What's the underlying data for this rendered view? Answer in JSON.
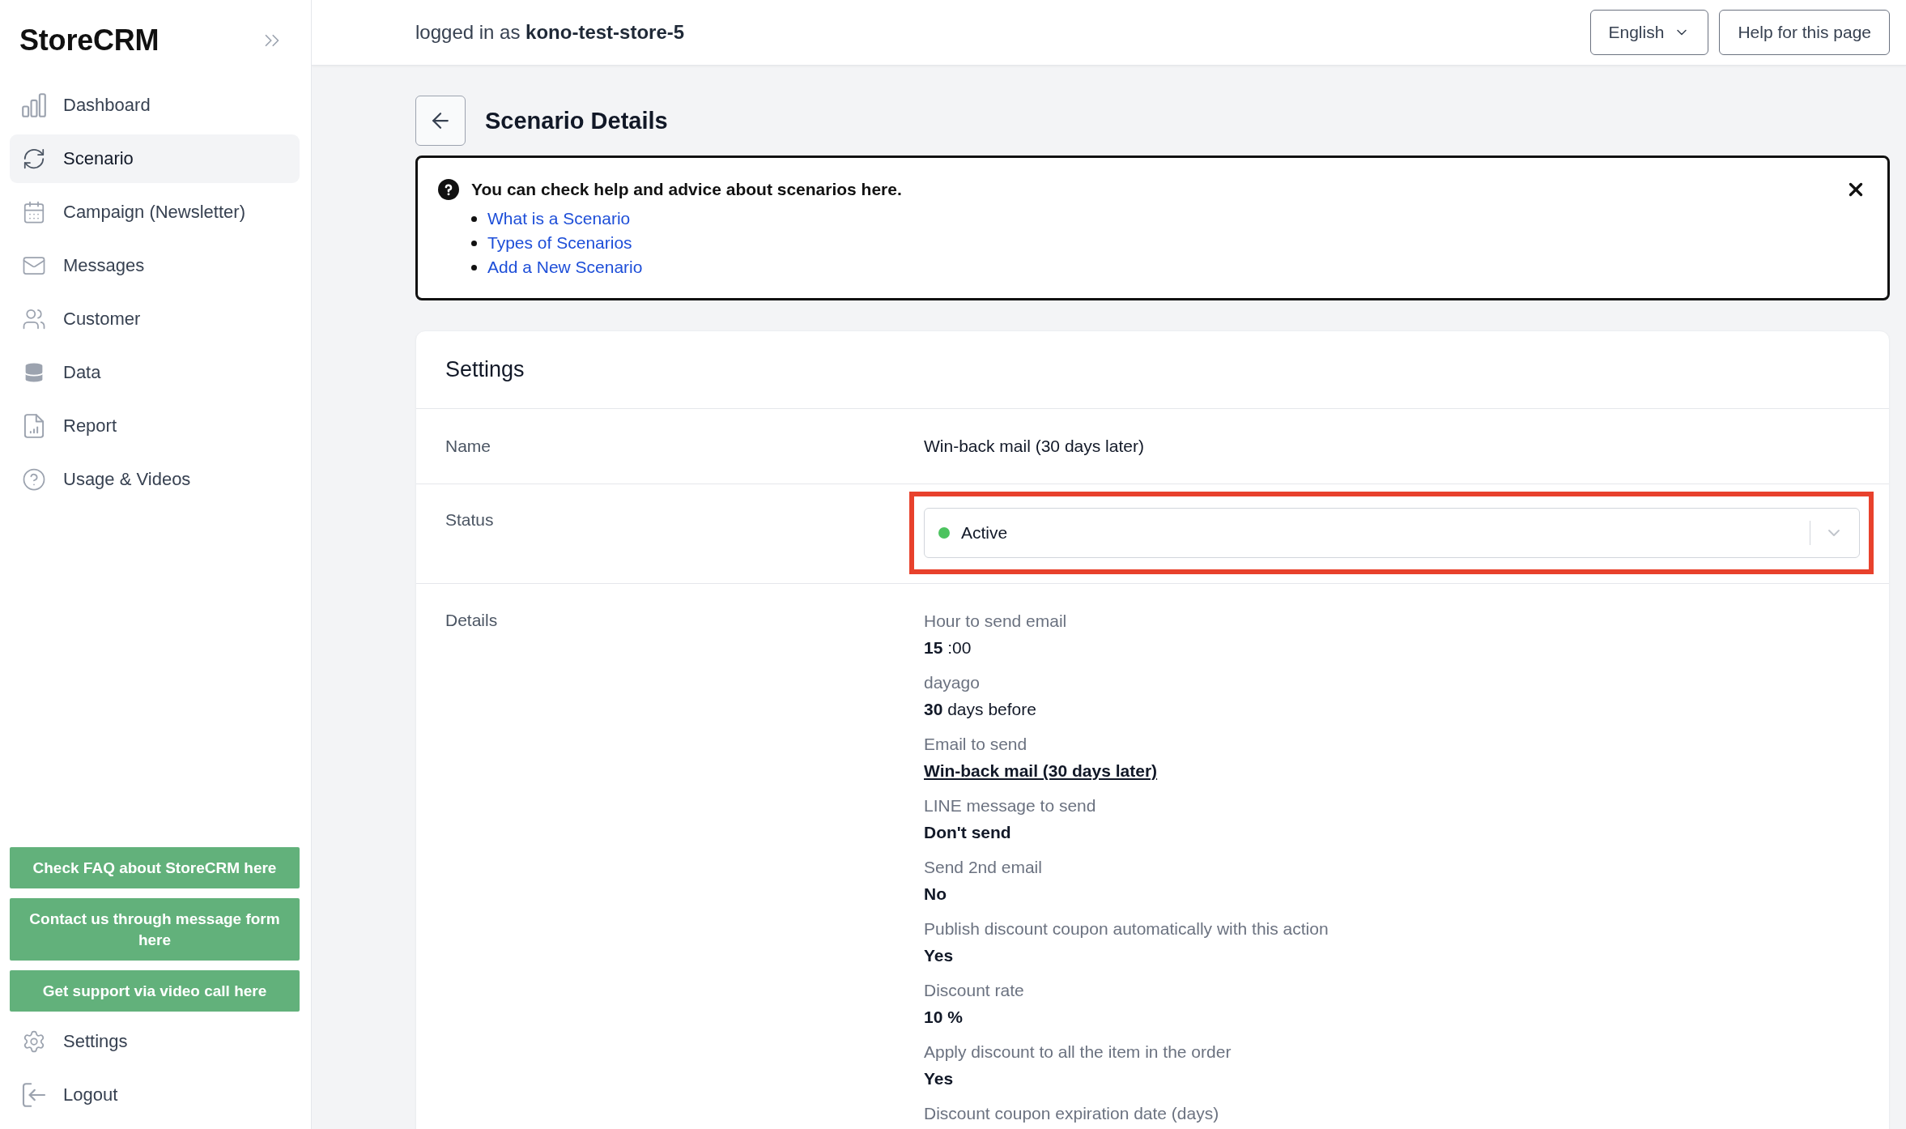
{
  "sidebar": {
    "logo": "StoreCRM",
    "nav_items": [
      {
        "label": "Dashboard",
        "selected": false
      },
      {
        "label": "Scenario",
        "selected": true
      },
      {
        "label": "Campaign (Newsletter)",
        "selected": false
      },
      {
        "label": "Messages",
        "selected": false
      },
      {
        "label": "Customer",
        "selected": false
      },
      {
        "label": "Data",
        "selected": false
      },
      {
        "label": "Report",
        "selected": false
      },
      {
        "label": "Usage & Videos",
        "selected": false
      }
    ],
    "support_buttons": [
      "Check FAQ about StoreCRM here",
      "Contact us through message form here",
      "Get support via video call here"
    ],
    "footer_items": [
      "Settings",
      "Logout"
    ]
  },
  "header": {
    "login_text": "logged in as **kono-test-store-5**",
    "language": "English",
    "help_button": "Help for this page"
  },
  "page_title": "Scenario Details",
  "help_box": {
    "heading": "You can check help and advice about scenarios here.",
    "links": [
      "What is a Scenario",
      "Types of Scenarios",
      "Add a New Scenario"
    ]
  },
  "settings": {
    "title": "Settings",
    "rows": [
      {
        "kind": "text",
        "label": "Name",
        "value": "Win-back mail (30 days later)"
      },
      {
        "kind": "select",
        "label": "Status",
        "value": "Active",
        "color": "#4cc35f",
        "highlighted": true
      },
      {
        "kind": "details",
        "label": "Details",
        "items": [
          {
            "label": "Hour to send email",
            "kind": "mixed",
            "value": "**15** :00"
          },
          {
            "label": "dayago",
            "kind": "mixed",
            "value": "**30** days before"
          },
          {
            "label": "Email to send",
            "kind": "link",
            "value": "Win-back mail (30 days later)"
          },
          {
            "label": "LINE message to send",
            "kind": "strong",
            "value": "Don't send"
          },
          {
            "label": "Send 2nd email",
            "kind": "strong",
            "value": "No"
          },
          {
            "label": "Publish discount coupon automatically with this action",
            "kind": "strong",
            "value": "Yes"
          },
          {
            "label": "Discount rate",
            "kind": "strong",
            "value": "10 %"
          },
          {
            "label": "Apply discount to all the item in the order",
            "kind": "strong",
            "value": "Yes"
          },
          {
            "label": "Discount coupon expiration date (days)"
          }
        ]
      }
    ]
  }
}
